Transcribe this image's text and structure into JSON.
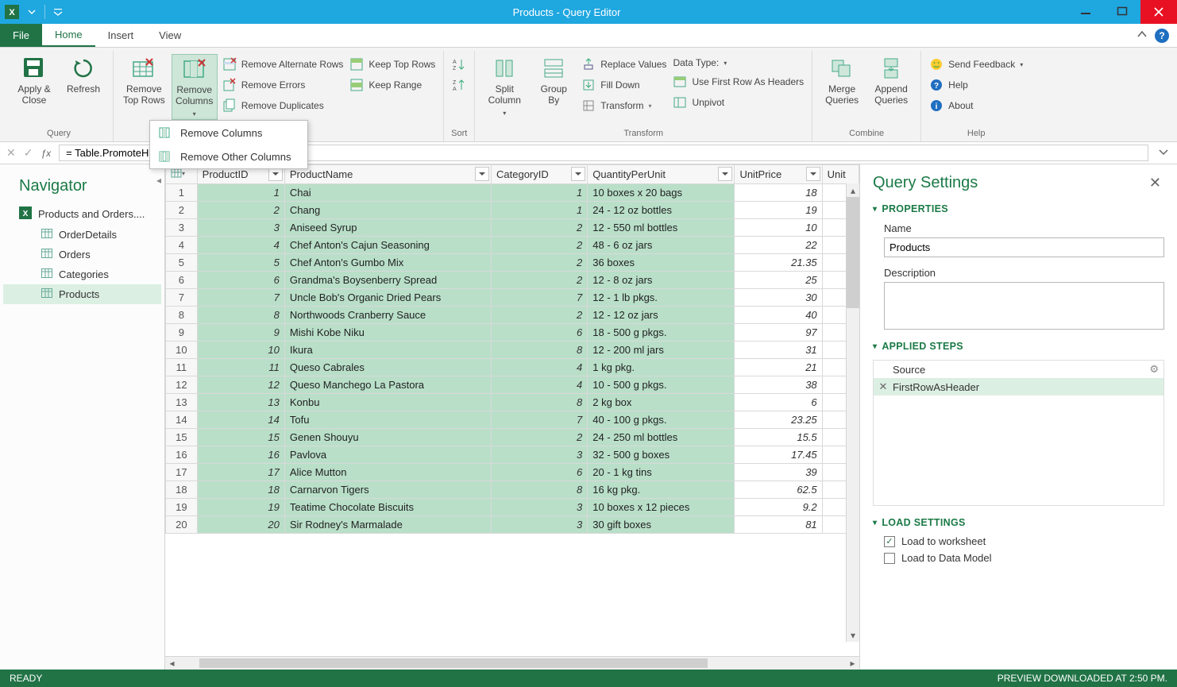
{
  "window": {
    "title": "Products - Query Editor"
  },
  "tabs": {
    "file": "File",
    "home": "Home",
    "insert": "Insert",
    "view": "View"
  },
  "ribbon": {
    "groups": {
      "query": "Query",
      "sort": "Sort",
      "transform": "Transform",
      "combine": "Combine",
      "help": "Help"
    },
    "apply_close": "Apply &\nClose",
    "refresh": "Refresh",
    "remove_top_rows": "Remove\nTop Rows",
    "remove_columns": "Remove\nColumns",
    "remove_alt_rows": "Remove Alternate Rows",
    "remove_errors": "Remove Errors",
    "remove_duplicates": "Remove Duplicates",
    "keep_top_rows": "Keep Top Rows",
    "keep_range": "Keep Range",
    "az": "A→Z",
    "za": "Z→A",
    "split_column": "Split\nColumn",
    "group_by": "Group\nBy",
    "replace_values": "Replace Values",
    "data_type": "Data Type:",
    "fill_down": "Fill Down",
    "first_row_headers": "Use First Row As Headers",
    "transform_btn": "Transform",
    "unpivot": "Unpivot",
    "merge_queries": "Merge\nQueries",
    "append_queries": "Append\nQueries",
    "send_feedback": "Send Feedback",
    "help_link": "Help",
    "about": "About"
  },
  "dropdown": {
    "remove_columns": "Remove Columns",
    "remove_other_columns": "Remove Other Columns"
  },
  "formula": "= Table.PromoteHeaders(Products)",
  "navigator": {
    "title": "Navigator",
    "root": "Products and Orders....",
    "items": [
      "OrderDetails",
      "Orders",
      "Categories",
      "Products"
    ],
    "selectedIndex": 3
  },
  "grid": {
    "columns": [
      "ProductID",
      "ProductName",
      "CategoryID",
      "QuantityPerUnit",
      "UnitPrice",
      "Unit"
    ],
    "rows": [
      {
        "ProductID": 1,
        "ProductName": "Chai",
        "CategoryID": 1,
        "QuantityPerUnit": "10 boxes x 20 bags",
        "UnitPrice": 18
      },
      {
        "ProductID": 2,
        "ProductName": "Chang",
        "CategoryID": 1,
        "QuantityPerUnit": "24 - 12 oz bottles",
        "UnitPrice": 19
      },
      {
        "ProductID": 3,
        "ProductName": "Aniseed Syrup",
        "CategoryID": 2,
        "QuantityPerUnit": "12 - 550 ml bottles",
        "UnitPrice": 10
      },
      {
        "ProductID": 4,
        "ProductName": "Chef Anton's Cajun Seasoning",
        "CategoryID": 2,
        "QuantityPerUnit": "48 - 6 oz jars",
        "UnitPrice": 22
      },
      {
        "ProductID": 5,
        "ProductName": "Chef Anton's Gumbo Mix",
        "CategoryID": 2,
        "QuantityPerUnit": "36 boxes",
        "UnitPrice": 21.35
      },
      {
        "ProductID": 6,
        "ProductName": "Grandma's Boysenberry Spread",
        "CategoryID": 2,
        "QuantityPerUnit": "12 - 8 oz jars",
        "UnitPrice": 25
      },
      {
        "ProductID": 7,
        "ProductName": "Uncle Bob's Organic Dried Pears",
        "CategoryID": 7,
        "QuantityPerUnit": "12 - 1 lb pkgs.",
        "UnitPrice": 30
      },
      {
        "ProductID": 8,
        "ProductName": "Northwoods Cranberry Sauce",
        "CategoryID": 2,
        "QuantityPerUnit": "12 - 12 oz jars",
        "UnitPrice": 40
      },
      {
        "ProductID": 9,
        "ProductName": "Mishi Kobe Niku",
        "CategoryID": 6,
        "QuantityPerUnit": "18 - 500 g pkgs.",
        "UnitPrice": 97
      },
      {
        "ProductID": 10,
        "ProductName": "Ikura",
        "CategoryID": 8,
        "QuantityPerUnit": "12 - 200 ml jars",
        "UnitPrice": 31
      },
      {
        "ProductID": 11,
        "ProductName": "Queso Cabrales",
        "CategoryID": 4,
        "QuantityPerUnit": "1 kg pkg.",
        "UnitPrice": 21
      },
      {
        "ProductID": 12,
        "ProductName": "Queso Manchego La Pastora",
        "CategoryID": 4,
        "QuantityPerUnit": "10 - 500 g pkgs.",
        "UnitPrice": 38
      },
      {
        "ProductID": 13,
        "ProductName": "Konbu",
        "CategoryID": 8,
        "QuantityPerUnit": "2 kg box",
        "UnitPrice": 6
      },
      {
        "ProductID": 14,
        "ProductName": "Tofu",
        "CategoryID": 7,
        "QuantityPerUnit": "40 - 100 g pkgs.",
        "UnitPrice": 23.25
      },
      {
        "ProductID": 15,
        "ProductName": "Genen Shouyu",
        "CategoryID": 2,
        "QuantityPerUnit": "24 - 250 ml bottles",
        "UnitPrice": 15.5
      },
      {
        "ProductID": 16,
        "ProductName": "Pavlova",
        "CategoryID": 3,
        "QuantityPerUnit": "32 - 500 g boxes",
        "UnitPrice": 17.45
      },
      {
        "ProductID": 17,
        "ProductName": "Alice Mutton",
        "CategoryID": 6,
        "QuantityPerUnit": "20 - 1 kg tins",
        "UnitPrice": 39
      },
      {
        "ProductID": 18,
        "ProductName": "Carnarvon Tigers",
        "CategoryID": 8,
        "QuantityPerUnit": "16 kg pkg.",
        "UnitPrice": 62.5
      },
      {
        "ProductID": 19,
        "ProductName": "Teatime Chocolate Biscuits",
        "CategoryID": 3,
        "QuantityPerUnit": "10 boxes x 12 pieces",
        "UnitPrice": 9.2
      },
      {
        "ProductID": 20,
        "ProductName": "Sir Rodney's Marmalade",
        "CategoryID": 3,
        "QuantityPerUnit": "30 gift boxes",
        "UnitPrice": 81
      }
    ]
  },
  "settings": {
    "title": "Query Settings",
    "sections": {
      "properties": "PROPERTIES",
      "applied_steps": "APPLIED STEPS",
      "load_settings": "LOAD SETTINGS"
    },
    "name_label": "Name",
    "name_value": "Products",
    "description_label": "Description",
    "steps": [
      "Source",
      "FirstRowAsHeader"
    ],
    "selected_step": 1,
    "load_worksheet": "Load to worksheet",
    "load_datamodel": "Load to Data Model",
    "load_worksheet_checked": true,
    "load_datamodel_checked": false
  },
  "status": {
    "left": "READY",
    "right": "PREVIEW DOWNLOADED AT 2:50 PM."
  }
}
